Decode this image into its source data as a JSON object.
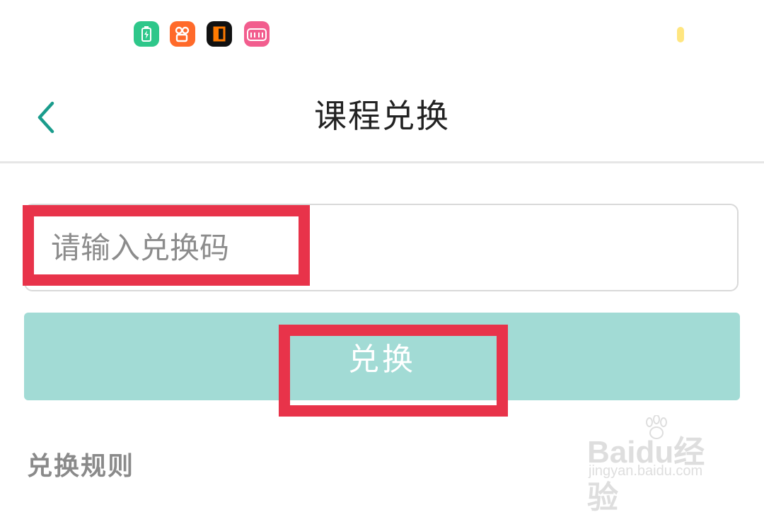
{
  "status_bar": {
    "apps": [
      {
        "name": "battery-app",
        "color": "#2ec78a"
      },
      {
        "name": "kuaishou-app",
        "color": "#ff6a2a"
      },
      {
        "name": "black-app",
        "color": "#111111"
      },
      {
        "name": "bilibili-app",
        "color": "#f25d8e"
      }
    ]
  },
  "header": {
    "title": "课程兑换",
    "back_icon": "chevron-left-icon",
    "accent": "#1a9c8c"
  },
  "redeem_form": {
    "code_placeholder": "请输入兑换码",
    "code_value": "",
    "submit_label": "兑换",
    "button_color": "#a2dbd5"
  },
  "rules": {
    "heading": "兑换规则"
  },
  "annotation": {
    "highlight_color": "#e8334a"
  },
  "watermark": {
    "brand": "Baidu",
    "suffix": "经验",
    "sub": "jingyan.baidu.com"
  }
}
